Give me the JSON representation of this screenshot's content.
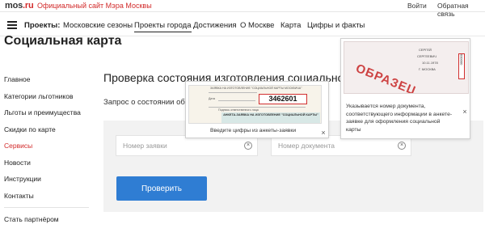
{
  "topbar": {
    "logo_main": "mos",
    "logo_suffix": ".ru",
    "official": "Официальный сайт Мэра Москвы",
    "login": "Войти",
    "feedback": "Обратная связь"
  },
  "nav": {
    "items": [
      {
        "label": "Проекты:"
      },
      {
        "label": "Московские сезоны"
      },
      {
        "label": "Проекты города"
      },
      {
        "label": "Достижения"
      },
      {
        "label": "О Москве"
      },
      {
        "label": "Карта"
      },
      {
        "label": "Цифры и факты"
      }
    ]
  },
  "page_title": "Социальная карта",
  "sidebar": {
    "items": [
      {
        "label": "Главное"
      },
      {
        "label": "Категории льготников"
      },
      {
        "label": "Льготы и преимущества"
      },
      {
        "label": "Скидки по карте"
      },
      {
        "label": "Сервисы"
      },
      {
        "label": "Новости"
      },
      {
        "label": "Инструкции"
      },
      {
        "label": "Контакты"
      }
    ],
    "partner": "Стать партнёром"
  },
  "main": {
    "title": "Проверка состояния изготовления социальной",
    "request": "Запрос о состоянии обработки",
    "request_tail": "ы,",
    "application_placeholder": "Номер заявки",
    "document_placeholder": "Номер документа",
    "clear_symbol": "×",
    "submit_label": "Проверить"
  },
  "tooltip_application": {
    "image_header": "ЗАЯВКА НА ИЗГОТОВЛЕНИЕ \"СОЦИАЛЬНОЙ КАРТЫ МОСКВИЧА\"",
    "image_date": "Дата",
    "image_number": "3462601",
    "image_signature": "Подпись ответственного лица",
    "image_form_title": "АНКЕТА-ЗАЯВКА НА ИЗГОТОВЛЕНИЕ \"СОЦИАЛЬНОЙ КАРТЫ\"",
    "text": "Введите цифры из анкеты-заявки",
    "close_symbol": "×"
  },
  "tooltip_document": {
    "stamp": "ОБРАЗЕЦ",
    "surname": "СЕРГЕЙ",
    "name": "СЕРГЕЕВИЧ",
    "date": "10.11.1978",
    "city": "Г. МОСКВА",
    "series": "000000",
    "text": "Указывается номер документа, соответствующего информации в анкете-заявке для оформления социальной карты",
    "close_symbol": "×"
  }
}
